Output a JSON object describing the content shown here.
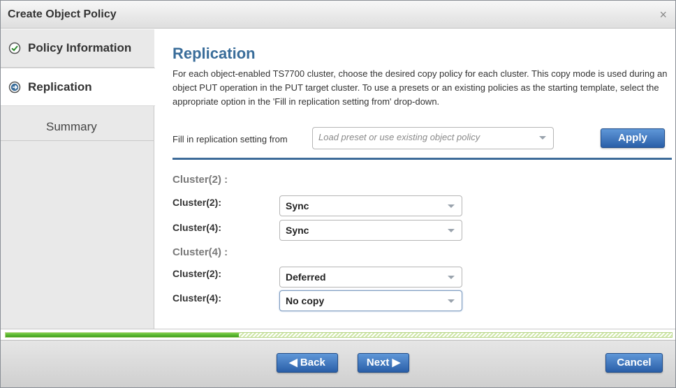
{
  "window": {
    "title": "Create Object Policy",
    "close_glyph": "×"
  },
  "sidebar": {
    "steps": [
      {
        "label": "Policy Information",
        "state": "complete",
        "icon": "checkmark-circle-icon"
      },
      {
        "label": "Replication",
        "state": "current",
        "icon": "arrow-right-circle-icon"
      },
      {
        "label": "Summary",
        "state": "pending"
      }
    ]
  },
  "main": {
    "heading": "Replication",
    "description": "For each object-enabled TS7700 cluster, choose the desired copy policy for each cluster. This copy mode is used during an object PUT operation in the PUT target cluster. To use a presets or an existing policies as the starting template, select the appropriate option in the 'Fill in replication setting from' drop-down.",
    "fill_label": "Fill in replication setting from",
    "fill_placeholder": "Load preset or use existing object policy",
    "apply_label": "Apply",
    "groups": [
      {
        "title": "Cluster(2) :",
        "rows": [
          {
            "label": "Cluster(2):",
            "value": "Sync"
          },
          {
            "label": "Cluster(4):",
            "value": "Sync"
          }
        ]
      },
      {
        "title": "Cluster(4) :",
        "rows": [
          {
            "label": "Cluster(2):",
            "value": "Deferred"
          },
          {
            "label": "Cluster(4):",
            "value": "No copy"
          }
        ]
      }
    ]
  },
  "progress": {
    "fraction": 0.35
  },
  "footer": {
    "back_label": "◀ Back",
    "next_label": "Next ▶",
    "cancel_label": "Cancel"
  },
  "colors": {
    "heading": "#3a6d9a",
    "button": "#2a5fa8",
    "progress": "#3c9e1b",
    "divider": "#3d6b99"
  }
}
